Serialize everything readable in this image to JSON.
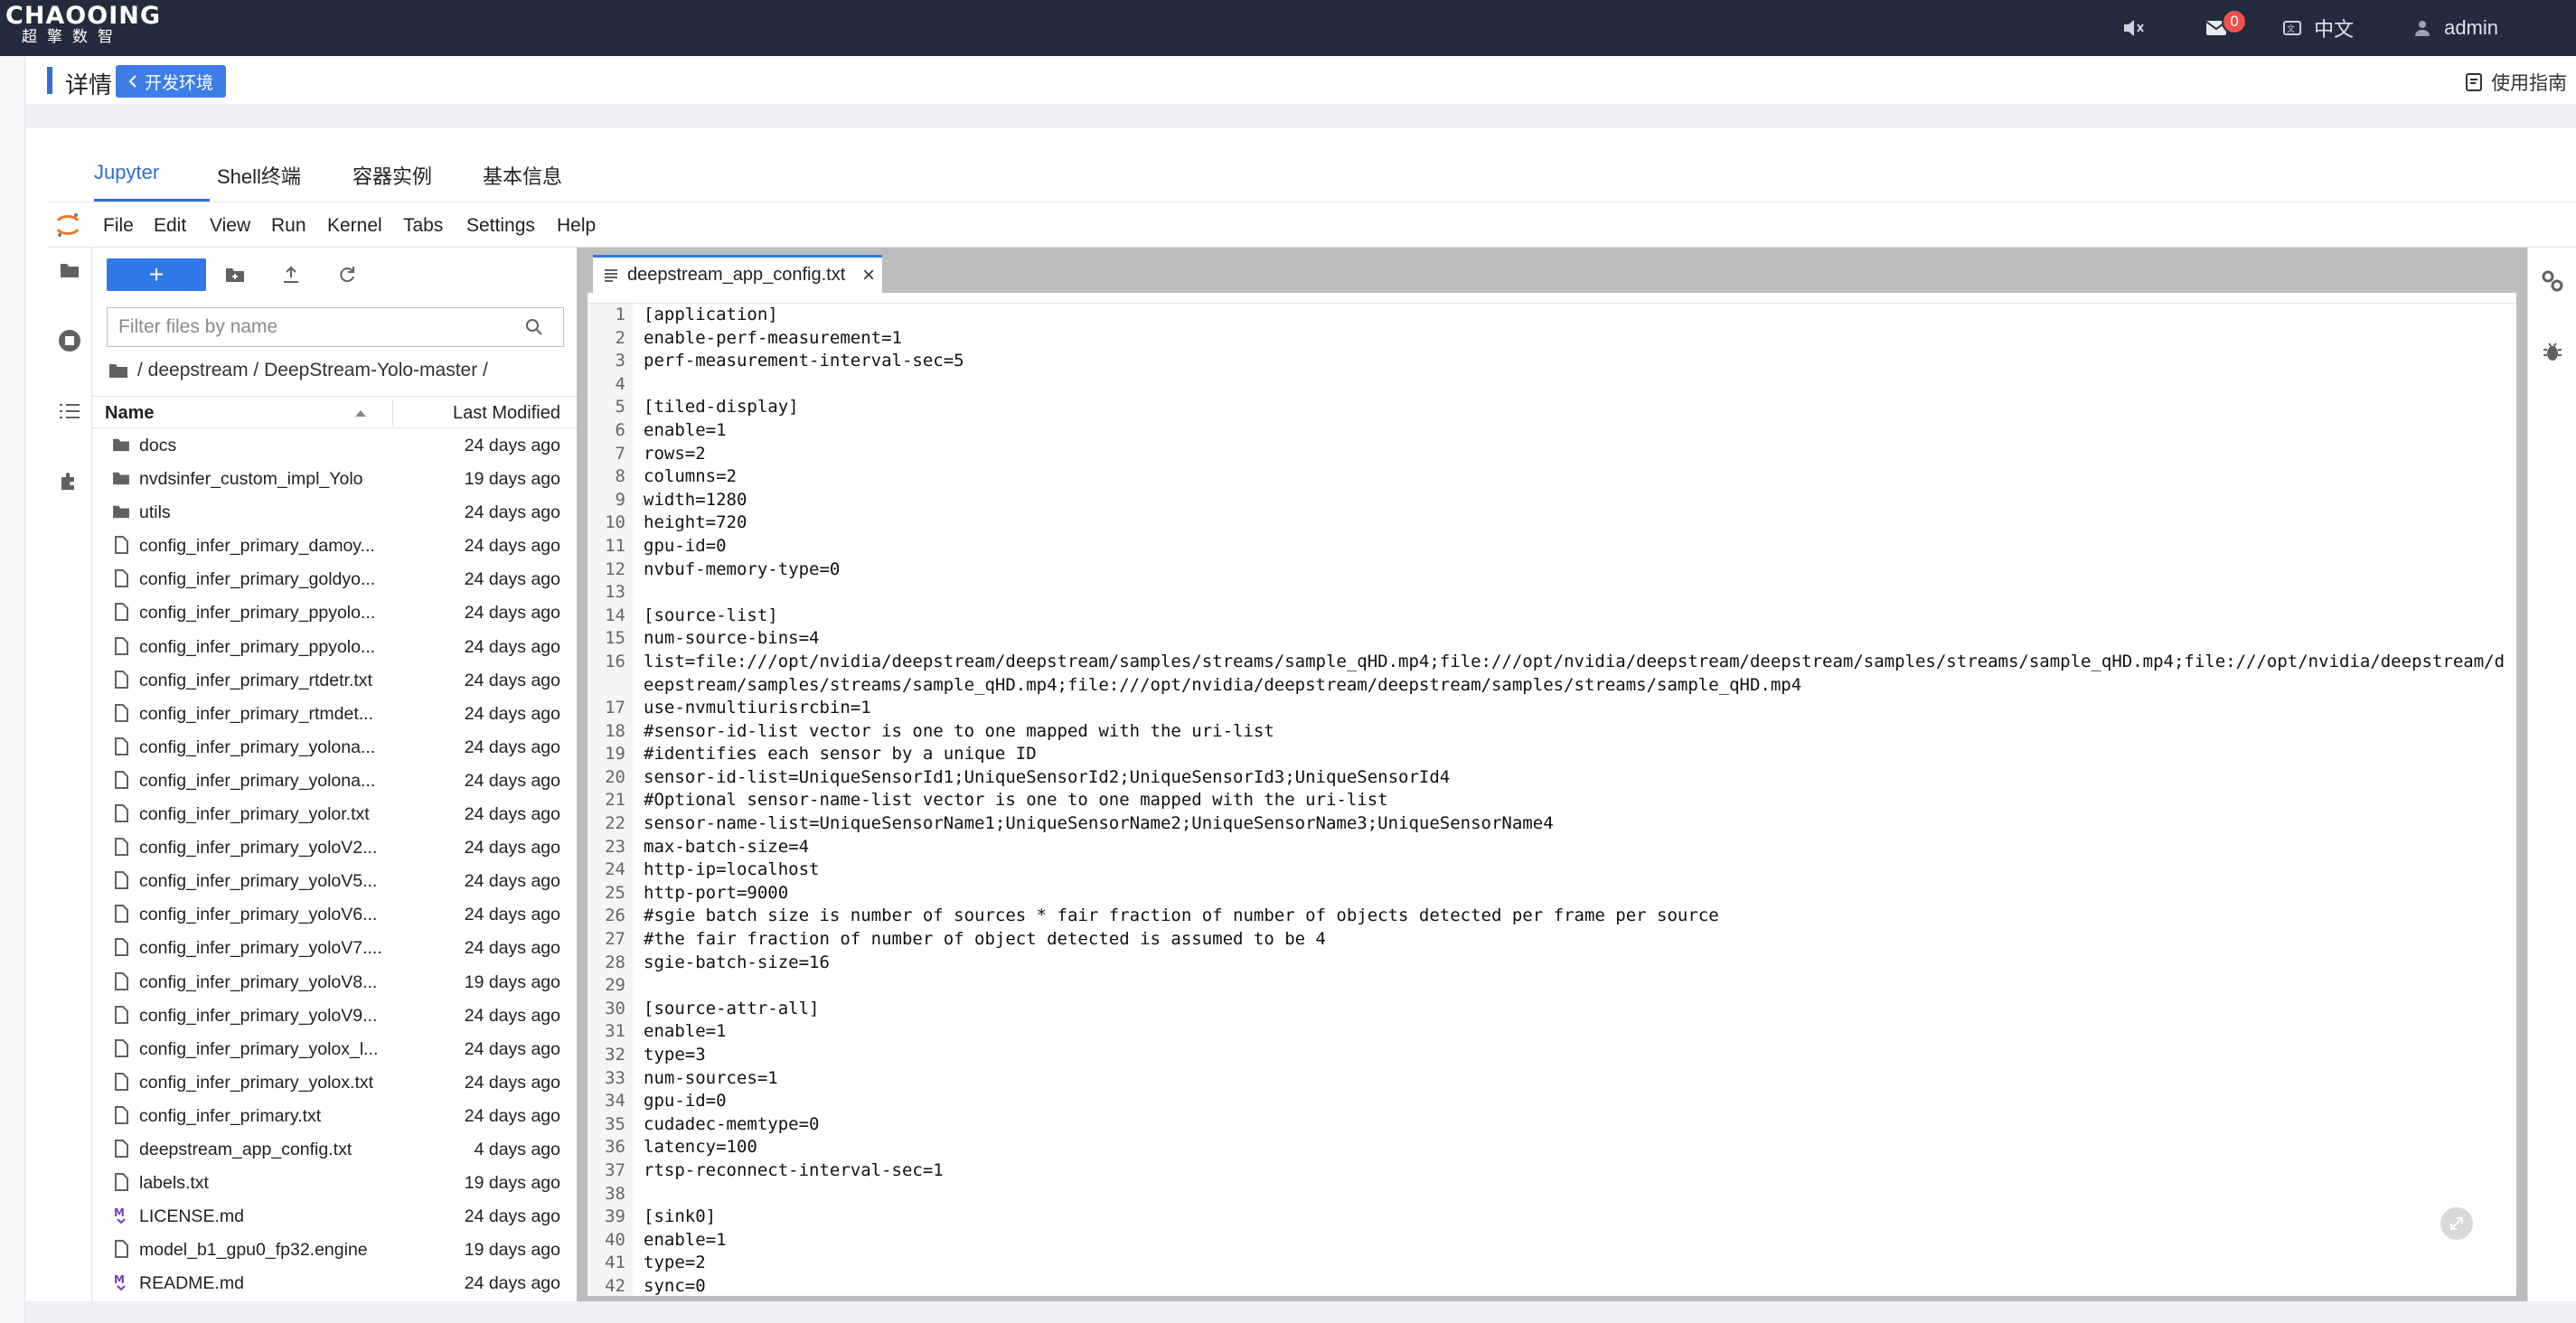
{
  "brand": {
    "name": "CHAOOING",
    "sub": "超擎数智"
  },
  "topbar": {
    "mail_count": "0",
    "language": "中文",
    "user": "admin"
  },
  "header": {
    "title": "详情",
    "back_button": "开发环境",
    "guide": "使用指南"
  },
  "tabs": [
    {
      "label": "Jupyter",
      "active": true
    },
    {
      "label": "Shell终端",
      "active": false
    },
    {
      "label": "容器实例",
      "active": false
    },
    {
      "label": "基本信息",
      "active": false
    }
  ],
  "menu": [
    "File",
    "Edit",
    "View",
    "Run",
    "Kernel",
    "Tabs",
    "Settings",
    "Help"
  ],
  "filebrowser": {
    "filter_placeholder": "Filter files by name",
    "breadcrumb": "/ deepstream / DeepStream-Yolo-master /",
    "col_name": "Name",
    "col_modified": "Last Modified",
    "files": [
      {
        "type": "folder",
        "name": "docs",
        "modified": "24 days ago"
      },
      {
        "type": "folder",
        "name": "nvdsinfer_custom_impl_Yolo",
        "modified": "19 days ago"
      },
      {
        "type": "folder",
        "name": "utils",
        "modified": "24 days ago"
      },
      {
        "type": "file",
        "name": "config_infer_primary_damoy...",
        "modified": "24 days ago"
      },
      {
        "type": "file",
        "name": "config_infer_primary_goldyo...",
        "modified": "24 days ago"
      },
      {
        "type": "file",
        "name": "config_infer_primary_ppyolo...",
        "modified": "24 days ago"
      },
      {
        "type": "file",
        "name": "config_infer_primary_ppyolo...",
        "modified": "24 days ago"
      },
      {
        "type": "file",
        "name": "config_infer_primary_rtdetr.txt",
        "modified": "24 days ago"
      },
      {
        "type": "file",
        "name": "config_infer_primary_rtmdet...",
        "modified": "24 days ago"
      },
      {
        "type": "file",
        "name": "config_infer_primary_yolona...",
        "modified": "24 days ago"
      },
      {
        "type": "file",
        "name": "config_infer_primary_yolona...",
        "modified": "24 days ago"
      },
      {
        "type": "file",
        "name": "config_infer_primary_yolor.txt",
        "modified": "24 days ago"
      },
      {
        "type": "file",
        "name": "config_infer_primary_yoloV2...",
        "modified": "24 days ago"
      },
      {
        "type": "file",
        "name": "config_infer_primary_yoloV5...",
        "modified": "24 days ago"
      },
      {
        "type": "file",
        "name": "config_infer_primary_yoloV6...",
        "modified": "24 days ago"
      },
      {
        "type": "file",
        "name": "config_infer_primary_yoloV7....",
        "modified": "24 days ago"
      },
      {
        "type": "file",
        "name": "config_infer_primary_yoloV8...",
        "modified": "19 days ago"
      },
      {
        "type": "file",
        "name": "config_infer_primary_yoloV9...",
        "modified": "24 days ago"
      },
      {
        "type": "file",
        "name": "config_infer_primary_yolox_l...",
        "modified": "24 days ago"
      },
      {
        "type": "file",
        "name": "config_infer_primary_yolox.txt",
        "modified": "24 days ago"
      },
      {
        "type": "file",
        "name": "config_infer_primary.txt",
        "modified": "24 days ago"
      },
      {
        "type": "file",
        "name": "deepstream_app_config.txt",
        "modified": "4 days ago"
      },
      {
        "type": "file",
        "name": "labels.txt",
        "modified": "19 days ago"
      },
      {
        "type": "markdown",
        "name": "LICENSE.md",
        "modified": "24 days ago"
      },
      {
        "type": "file",
        "name": "model_b1_gpu0_fp32.engine",
        "modified": "19 days ago"
      },
      {
        "type": "markdown",
        "name": "README.md",
        "modified": "24 days ago"
      }
    ]
  },
  "editor": {
    "tab_label": "deepstream_app_config.txt",
    "lines": [
      "[application]",
      "enable-perf-measurement=1",
      "perf-measurement-interval-sec=5",
      "",
      "[tiled-display]",
      "enable=1",
      "rows=2",
      "columns=2",
      "width=1280",
      "height=720",
      "gpu-id=0",
      "nvbuf-memory-type=0",
      "",
      "[source-list]",
      "num-source-bins=4",
      "list=file:///opt/nvidia/deepstream/deepstream/samples/streams/sample_qHD.mp4;file:///opt/nvidia/deepstream/deepstream/samples/streams/sample_qHD.mp4;file:///opt/nvidia/deepstream/deepstream/samples/streams/sample_qHD.mp4;file:///opt/nvidia/deepstream/deepstream/samples/streams/sample_qHD.mp4",
      "use-nvmultiurisrcbin=1",
      "#sensor-id-list vector is one to one mapped with the uri-list",
      "#identifies each sensor by a unique ID",
      "sensor-id-list=UniqueSensorId1;UniqueSensorId2;UniqueSensorId3;UniqueSensorId4",
      "#Optional sensor-name-list vector is one to one mapped with the uri-list",
      "sensor-name-list=UniqueSensorName1;UniqueSensorName2;UniqueSensorName3;UniqueSensorName4",
      "max-batch-size=4",
      "http-ip=localhost",
      "http-port=9000",
      "#sgie batch size is number of sources * fair fraction of number of objects detected per frame per source",
      "#the fair fraction of number of object detected is assumed to be 4",
      "sgie-batch-size=16",
      "",
      "[source-attr-all]",
      "enable=1",
      "type=3",
      "num-sources=1",
      "gpu-id=0",
      "cudadec-memtype=0",
      "latency=100",
      "rtsp-reconnect-interval-sec=1",
      "",
      "[sink0]",
      "enable=1",
      "type=2",
      "sync=0"
    ]
  },
  "colors": {
    "topbar": "#232c3c",
    "accent": "#2f6fd6",
    "primary_button": "#2f79e8",
    "badge": "#f05050"
  }
}
